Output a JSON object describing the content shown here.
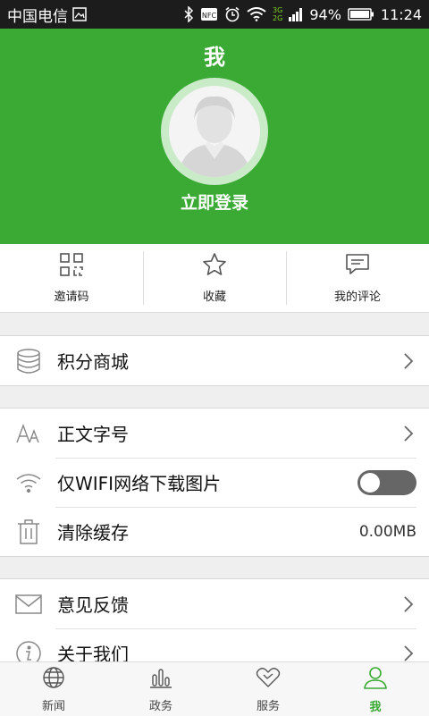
{
  "status_bar": {
    "carrier": "中国电信",
    "signal_label_top": "3G",
    "signal_label_bottom": "2G",
    "battery": "94%",
    "time": "11:24",
    "icons": [
      "image-icon",
      "bluetooth-icon",
      "nfc-icon",
      "alarm-icon",
      "wifi-icon",
      "signal-icon",
      "battery-icon"
    ]
  },
  "header": {
    "title": "我",
    "login_label": "立即登录",
    "background_color": "#3aaa35"
  },
  "quick_actions": [
    {
      "label": "邀请码",
      "icon": "qr-code-icon"
    },
    {
      "label": "收藏",
      "icon": "star-icon"
    },
    {
      "label": "我的评论",
      "icon": "comment-icon"
    }
  ],
  "menu": {
    "points_mall": {
      "label": "积分商城",
      "icon": "database-icon"
    },
    "font_size": {
      "label": "正文字号",
      "icon": "font-size-icon"
    },
    "wifi_images": {
      "label": "仅WIFI网络下载图片",
      "icon": "wifi-icon",
      "toggle_on": false
    },
    "clear_cache": {
      "label": "清除缓存",
      "icon": "trash-icon",
      "value": "0.00MB"
    },
    "feedback": {
      "label": "意见反馈",
      "icon": "mail-icon"
    },
    "about": {
      "label": "关于我们",
      "icon": "info-icon"
    }
  },
  "tabs": [
    {
      "label": "新闻",
      "icon": "globe-icon",
      "active": false
    },
    {
      "label": "政务",
      "icon": "bar-chart-icon",
      "active": false
    },
    {
      "label": "服务",
      "icon": "handshake-icon",
      "active": false
    },
    {
      "label": "我",
      "icon": "person-icon",
      "active": true
    }
  ],
  "accent_color": "#3aaa35"
}
